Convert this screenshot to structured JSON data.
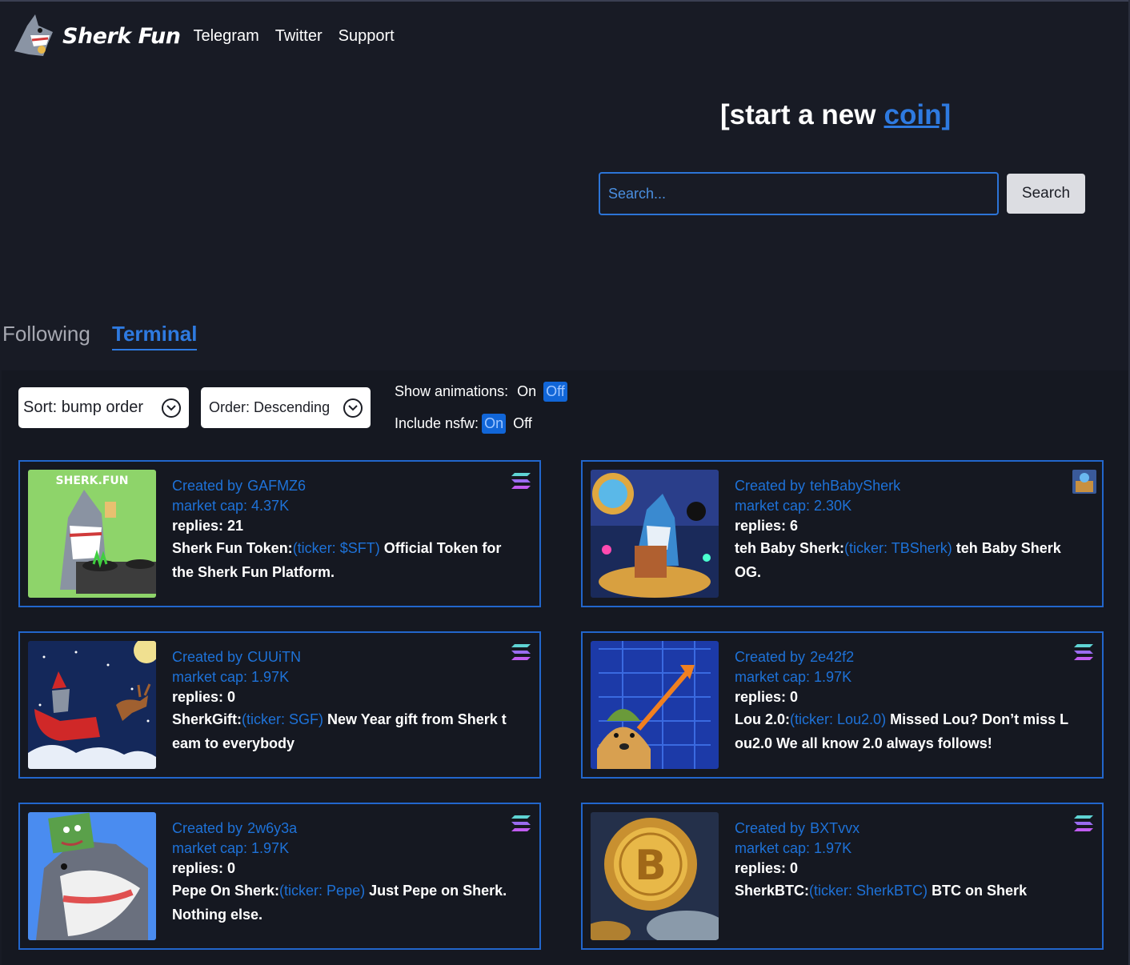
{
  "header": {
    "logo_text": "Sherk Fun",
    "nav": [
      "Telegram",
      "Twitter",
      "Support"
    ]
  },
  "hero": {
    "start_prefix": "[start a new",
    "start_link": "coin]"
  },
  "search": {
    "placeholder": "Search...",
    "button": "Search"
  },
  "tabs": {
    "following": "Following",
    "terminal": "Terminal"
  },
  "filters": {
    "sort": "Sort: bump order",
    "order": "Order: Descending",
    "animations_label": "Show animations:",
    "nsfw_label": "Include nsfw:",
    "on": "On",
    "off": "Off",
    "animations_state": "Off",
    "nsfw_state": "On"
  },
  "colors": {
    "accent": "#2e7ae0",
    "card_border": "#2266cc",
    "background": "#181b25"
  },
  "cards": [
    {
      "creator_label": "Created by",
      "creator": "GAFMZ6",
      "market_cap": "market cap: 4.37K",
      "replies": "replies: 21",
      "name": "Sherk Fun Token:",
      "ticker": "(ticker: $SFT)",
      "description": "Official Token for the Sherk Fun Platform.",
      "icon": "solana-icon"
    },
    {
      "creator_label": "Created by",
      "creator": "tehBabySherk",
      "market_cap": "market cap: 2.30K",
      "replies": "replies: 6",
      "name": "teh Baby Sherk:",
      "ticker": "(ticker: TBSherk)",
      "description": "teh Baby Sherk OG.",
      "icon": "mini-thumbnail"
    },
    {
      "creator_label": "Created by",
      "creator": "CUUiTN",
      "market_cap": "market cap: 1.97K",
      "replies": "replies: 0",
      "name": "SherkGift:",
      "ticker": "(ticker: SGF)",
      "description": "New Year gift from Sherk team to everybody",
      "icon": "solana-icon"
    },
    {
      "creator_label": "Created by",
      "creator": "2e42f2",
      "market_cap": "market cap: 1.97K",
      "replies": "replies: 0",
      "name": "Lou 2.0:",
      "ticker": "(ticker: Lou2.0)",
      "description": "Missed Lou? Don’t miss Lou2.0 We all know 2.0 always follows!",
      "icon": "solana-icon"
    },
    {
      "creator_label": "Created by",
      "creator": "2w6y3a",
      "market_cap": "market cap: 1.97K",
      "replies": "replies: 0",
      "name": "Pepe On Sherk:",
      "ticker": "(ticker: Pepe)",
      "description": "Just Pepe on Sherk. Nothing else.",
      "icon": "solana-icon"
    },
    {
      "creator_label": "Created by",
      "creator": "BXTvvx",
      "market_cap": "market cap: 1.97K",
      "replies": "replies: 0",
      "name": "SherkBTC:",
      "ticker": "(ticker: SherkBTC)",
      "description": "BTC on Sherk",
      "icon": "solana-icon"
    }
  ]
}
